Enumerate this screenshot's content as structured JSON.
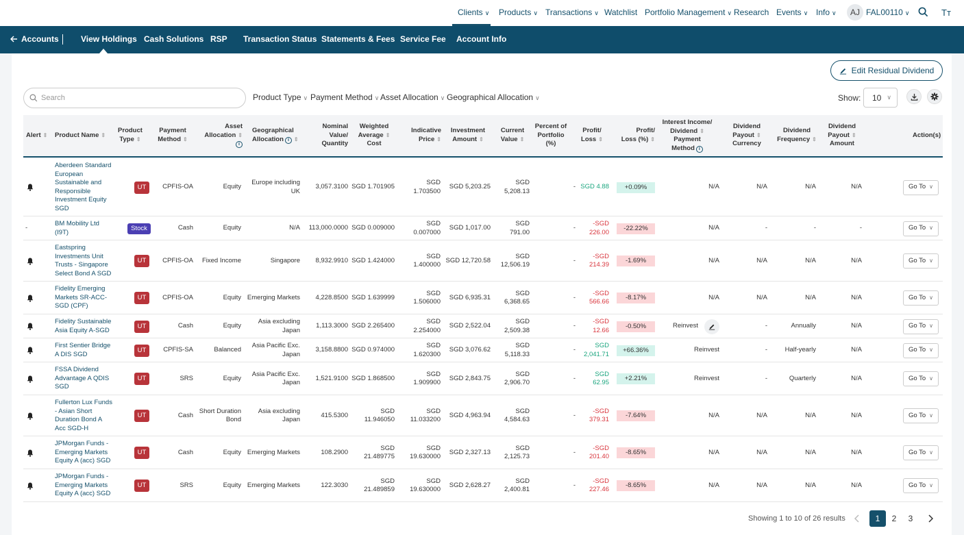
{
  "topnav": {
    "clients": "Clients",
    "products": "Products",
    "transactions": "Transactions",
    "watchlist": "Watchlist",
    "portfolio_management": "Portfolio Management",
    "research": "Research",
    "events": "Events",
    "info": "Info",
    "avatar_initials": "AJ",
    "user_id": "FAL00110",
    "font_size_label": "Tт"
  },
  "subnav": {
    "back": "Accounts",
    "items": [
      "View Holdings",
      "Cash Solutions",
      "RSP",
      "Transaction Status",
      "Statements & Fees",
      "Service Fee",
      "Account Info"
    ],
    "active": "View Holdings"
  },
  "toolbar": {
    "edit_residual_dividend": "Edit Residual Dividend",
    "search_placeholder": "Search",
    "filters": [
      "Product Type",
      "Payment Method",
      "Asset Allocation",
      "Geographical Allocation"
    ],
    "show_label": "Show:",
    "show_value": "10"
  },
  "table": {
    "headers": {
      "alert": "Alert",
      "product_name": "Product Name",
      "product_type": [
        "Product",
        "Type"
      ],
      "payment_method": [
        "Payment",
        "Method"
      ],
      "asset_allocation": [
        "Asset",
        "Allocation"
      ],
      "geo_allocation": [
        "Geographical",
        "Allocation"
      ],
      "nominal": [
        "Nominal",
        "Value/",
        "Quantity"
      ],
      "wac": [
        "Weighted",
        "Average",
        "Cost"
      ],
      "indicative": [
        "Indicative",
        "Price"
      ],
      "investment": [
        "Investment",
        "Amount"
      ],
      "current": [
        "Current",
        "Value"
      ],
      "percent_portfolio": [
        "Percent of",
        "Portfolio",
        "(%)"
      ],
      "pl": [
        "Profit/",
        "Loss"
      ],
      "pl_pct": [
        "Profit/",
        "Loss (%)"
      ],
      "interest": [
        "Interest Income/",
        "Dividend",
        "Payment",
        "Method"
      ],
      "div_currency": [
        "Dividend",
        "Payout",
        "Currency"
      ],
      "div_frequency": [
        "Dividend",
        "Frequency"
      ],
      "div_amount": [
        "Dividend",
        "Payout",
        "Amount"
      ],
      "actions": "Action(s)"
    },
    "rows": [
      {
        "alert": "bell",
        "name": [
          "Aberdeen Standard",
          "European",
          "Sustainable and",
          "Responsible",
          "Investment Equity",
          "SGD"
        ],
        "type": "UT",
        "payment": "CPFIS-OA",
        "asset": [
          "Equity"
        ],
        "geo": [
          "Europe including",
          "UK"
        ],
        "nominal": [
          "3,057.3100"
        ],
        "wac": [
          "SGD 1.701905"
        ],
        "price": [
          "SGD",
          "1.703500"
        ],
        "invest": [
          "SGD 5,203.25"
        ],
        "current": [
          "SGD",
          "5,208.13"
        ],
        "percent": "-",
        "pl": [
          "SGD 4.88"
        ],
        "pl_sign": "pos",
        "pl_pct": "+0.09%",
        "interest": "N/A",
        "currency": "N/A",
        "frequency": "N/A",
        "amount": "N/A",
        "action": "Go To"
      },
      {
        "alert": "-",
        "name": [
          "BM Mobility Ltd",
          "(I9T)"
        ],
        "type": "Stock",
        "payment": "Cash",
        "asset": [
          "Equity"
        ],
        "geo": [
          "N/A"
        ],
        "nominal": [
          "113,000.0000"
        ],
        "wac": [
          "SGD 0.009000"
        ],
        "price": [
          "SGD",
          "0.007000"
        ],
        "invest": [
          "SGD 1,017.00"
        ],
        "current": [
          "SGD",
          "791.00"
        ],
        "percent": "-",
        "pl": [
          "-SGD",
          "226.00"
        ],
        "pl_sign": "neg",
        "pl_pct": "-22.22%",
        "interest": "N/A",
        "currency": "-",
        "frequency": "-",
        "amount": "-",
        "action": "Go To"
      },
      {
        "alert": "bell",
        "name": [
          "Eastspring",
          "Investments Unit",
          "Trusts - Singapore",
          "Select Bond A SGD"
        ],
        "type": "UT",
        "payment": "CPFIS-OA",
        "asset": [
          "Fixed Income"
        ],
        "geo": [
          "Singapore"
        ],
        "nominal": [
          "8,932.9910"
        ],
        "wac": [
          "SGD 1.424000"
        ],
        "price": [
          "SGD",
          "1.400000"
        ],
        "invest": [
          "SGD 12,720.58"
        ],
        "current": [
          "SGD",
          "12,506.19"
        ],
        "percent": "-",
        "pl": [
          "-SGD",
          "214.39"
        ],
        "pl_sign": "neg",
        "pl_pct": "-1.69%",
        "interest": "N/A",
        "currency": "N/A",
        "frequency": "N/A",
        "amount": "N/A",
        "action": "Go To"
      },
      {
        "alert": "bell",
        "name": [
          "Fidelity Emerging",
          "Markets SR-ACC-",
          "SGD (CPF)"
        ],
        "type": "UT",
        "payment": "CPFIS-OA",
        "asset": [
          "Equity"
        ],
        "geo": [
          "Emerging Markets"
        ],
        "nominal": [
          "4,228.8500"
        ],
        "wac": [
          "SGD 1.639999"
        ],
        "price": [
          "SGD",
          "1.506000"
        ],
        "invest": [
          "SGD 6,935.31"
        ],
        "current": [
          "SGD",
          "6,368.65"
        ],
        "percent": "-",
        "pl": [
          "-SGD",
          "566.66"
        ],
        "pl_sign": "neg",
        "pl_pct": "-8.17%",
        "interest": "N/A",
        "currency": "N/A",
        "frequency": "N/A",
        "amount": "N/A",
        "action": "Go To"
      },
      {
        "alert": "bell",
        "name": [
          "Fidelity Sustainable",
          "Asia Equity A-SGD"
        ],
        "type": "UT",
        "payment": "Cash",
        "asset": [
          "Equity"
        ],
        "geo": [
          "Asia excluding",
          "Japan"
        ],
        "nominal": [
          "1,113.3000"
        ],
        "wac": [
          "SGD 2.265400"
        ],
        "price": [
          "SGD",
          "2.254000"
        ],
        "invest": [
          "SGD 2,522.04"
        ],
        "current": [
          "SGD",
          "2,509.38"
        ],
        "percent": "-",
        "pl": [
          "-SGD",
          "12.66"
        ],
        "pl_sign": "neg",
        "pl_pct": "-0.50%",
        "interest": "Reinvest",
        "interest_edit": true,
        "currency": "-",
        "frequency": "Annually",
        "amount": "N/A",
        "action": "Go To"
      },
      {
        "alert": "bell",
        "name": [
          "First Sentier Bridge",
          "A DIS SGD"
        ],
        "type": "UT",
        "payment": "CPFIS-SA",
        "asset": [
          "Balanced"
        ],
        "geo": [
          "Asia Pacific Exc.",
          "Japan"
        ],
        "nominal": [
          "3,158.8800"
        ],
        "wac": [
          "SGD 0.974000"
        ],
        "price": [
          "SGD",
          "1.620300"
        ],
        "invest": [
          "SGD 3,076.62"
        ],
        "current": [
          "SGD",
          "5,118.33"
        ],
        "percent": "-",
        "pl": [
          "SGD",
          "2,041.71"
        ],
        "pl_sign": "pos",
        "pl_pct": "+66.36%",
        "interest": "Reinvest",
        "currency": "-",
        "frequency": "Half-yearly",
        "amount": "N/A",
        "action": "Go To"
      },
      {
        "alert": "bell",
        "name": [
          "FSSA Dividend",
          "Advantage A QDIS",
          "SGD"
        ],
        "type": "UT",
        "payment": "SRS",
        "asset": [
          "Equity"
        ],
        "geo": [
          "Asia Pacific Exc.",
          "Japan"
        ],
        "nominal": [
          "1,521.9100"
        ],
        "wac": [
          "SGD 1.868500"
        ],
        "price": [
          "SGD",
          "1.909900"
        ],
        "invest": [
          "SGD 2,843.75"
        ],
        "current": [
          "SGD",
          "2,906.70"
        ],
        "percent": "-",
        "pl": [
          "SGD",
          "62.95"
        ],
        "pl_sign": "pos",
        "pl_pct": "+2.21%",
        "interest": "Reinvest",
        "currency": "-",
        "frequency": "Quarterly",
        "amount": "N/A",
        "action": "Go To"
      },
      {
        "alert": "bell",
        "name": [
          "Fullerton Lux Funds",
          "- Asian Short",
          "Duration Bond A",
          "Acc SGD-H"
        ],
        "type": "UT",
        "payment": "Cash",
        "asset": [
          "Short Duration",
          "Bond"
        ],
        "geo": [
          "Asia excluding",
          "Japan"
        ],
        "nominal": [
          "415.5300"
        ],
        "wac": [
          "SGD",
          "11.946050"
        ],
        "price": [
          "SGD",
          "11.033200"
        ],
        "invest": [
          "SGD 4,963.94"
        ],
        "current": [
          "SGD",
          "4,584.63"
        ],
        "percent": "-",
        "pl": [
          "-SGD",
          "379.31"
        ],
        "pl_sign": "neg",
        "pl_pct": "-7.64%",
        "interest": "N/A",
        "currency": "N/A",
        "frequency": "N/A",
        "amount": "N/A",
        "action": "Go To"
      },
      {
        "alert": "bell",
        "name": [
          "JPMorgan Funds -",
          "Emerging Markets",
          "Equity A (acc) SGD"
        ],
        "type": "UT",
        "payment": "Cash",
        "asset": [
          "Equity"
        ],
        "geo": [
          "Emerging Markets"
        ],
        "nominal": [
          "108.2900"
        ],
        "wac": [
          "SGD",
          "21.489775"
        ],
        "price": [
          "SGD",
          "19.630000"
        ],
        "invest": [
          "SGD 2,327.13"
        ],
        "current": [
          "SGD",
          "2,125.73"
        ],
        "percent": "-",
        "pl": [
          "-SGD",
          "201.40"
        ],
        "pl_sign": "neg",
        "pl_pct": "-8.65%",
        "interest": "N/A",
        "currency": "N/A",
        "frequency": "N/A",
        "amount": "N/A",
        "action": "Go To"
      },
      {
        "alert": "bell",
        "name": [
          "JPMorgan Funds -",
          "Emerging Markets",
          "Equity A (acc) SGD"
        ],
        "type": "UT",
        "payment": "SRS",
        "asset": [
          "Equity"
        ],
        "geo": [
          "Emerging Markets"
        ],
        "nominal": [
          "122.3030"
        ],
        "wac": [
          "SGD",
          "21.489859"
        ],
        "price": [
          "SGD",
          "19.630000"
        ],
        "invest": [
          "SGD 2,628.27"
        ],
        "current": [
          "SGD",
          "2,400.81"
        ],
        "percent": "-",
        "pl": [
          "-SGD",
          "227.46"
        ],
        "pl_sign": "neg",
        "pl_pct": "-8.65%",
        "interest": "N/A",
        "currency": "N/A",
        "frequency": "N/A",
        "amount": "N/A",
        "action": "Go To"
      }
    ]
  },
  "pagination": {
    "summary": "Showing 1 to 10 of 26 results",
    "pages": [
      "1",
      "2",
      "3"
    ],
    "current": "1"
  },
  "colors": {
    "brand": "#0f4d6b",
    "positive": "#1aa57e",
    "negative": "#d9363e",
    "ut_badge": "#b8343a",
    "stock_badge": "#4b3fb3"
  }
}
